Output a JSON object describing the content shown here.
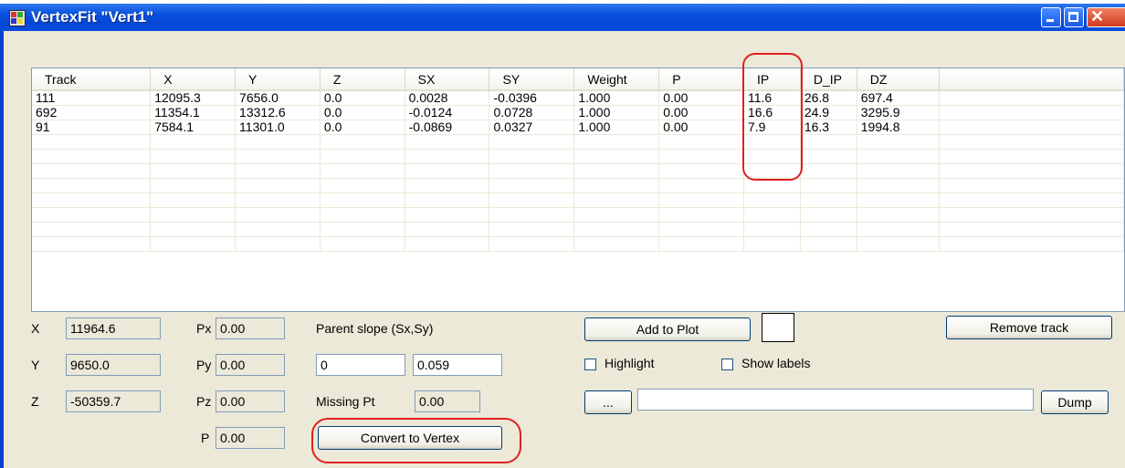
{
  "window": {
    "title": "VertexFit \"Vert1\"",
    "controls": {
      "minimize": "minimize",
      "maximize": "maximize",
      "close": "close"
    }
  },
  "tracks": {
    "columns": [
      "Track",
      "X",
      "Y",
      "Z",
      "SX",
      "SY",
      "Weight",
      "P",
      "IP",
      "D_IP",
      "DZ"
    ],
    "rows": [
      [
        "111",
        "12095.3",
        "7656.0",
        "0.0",
        "0.0028",
        "-0.0396",
        "1.000",
        "0.00",
        "11.6",
        "26.8",
        "697.4"
      ],
      [
        "692",
        "11354.1",
        "13312.6",
        "0.0",
        "-0.0124",
        "0.0728",
        "1.000",
        "0.00",
        "16.6",
        "24.9",
        "3295.9"
      ],
      [
        "91",
        "7584.1",
        "11301.0",
        "0.0",
        "-0.0869",
        "0.0327",
        "1.000",
        "0.00",
        "7.9",
        "16.3",
        "1994.8"
      ]
    ],
    "empty_rows": 8
  },
  "position": {
    "x_label": "X",
    "x_value": "11964.6",
    "y_label": "Y",
    "y_value": "9650.0",
    "z_label": "Z",
    "z_value": "-50359.7"
  },
  "momentum": {
    "px_label": "Px",
    "px_value": "0.00",
    "py_label": "Py",
    "py_value": "0.00",
    "pz_label": "Pz",
    "pz_value": "0.00",
    "p_label": "P",
    "p_value": "0.00"
  },
  "parent": {
    "slope_label": "Parent slope (Sx,Sy)",
    "sx_value": "0",
    "sy_value": "0.059",
    "missing_label": "Missing Pt",
    "missing_value": "0.00",
    "convert_button": "Convert to Vertex"
  },
  "plot": {
    "add_button": "Add to Plot",
    "highlight_label": "Highlight",
    "show_labels_label": "Show labels",
    "browse_button": "...",
    "path_value": "",
    "dump_button": "Dump",
    "remove_button": "Remove track"
  },
  "colors": {
    "annotation": "#e02020",
    "title_bar": "#0a55e0",
    "client_bg": "#ece9d8"
  }
}
